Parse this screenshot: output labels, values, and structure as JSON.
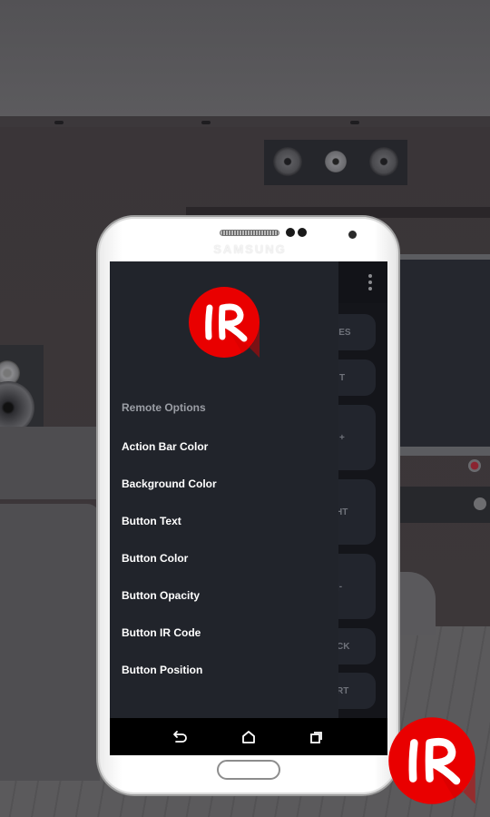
{
  "device": {
    "brand": "SAMSUNG"
  },
  "app": {
    "logo_text": "IR",
    "brand_color": "#e90000",
    "overflow_menu_icon": "more-vert-icon",
    "remote_buttons_partial": [
      "HES",
      "T",
      "+",
      "HT",
      "|-",
      "CK",
      "RT"
    ]
  },
  "drawer": {
    "section_header": "Remote Options",
    "items": [
      {
        "label": "Action Bar Color"
      },
      {
        "label": "Background Color"
      },
      {
        "label": "Button Text"
      },
      {
        "label": "Button Color"
      },
      {
        "label": "Button Opacity"
      },
      {
        "label": "Button IR Code"
      },
      {
        "label": "Button Position"
      }
    ]
  },
  "nav_bar": {
    "back_icon": "back-icon",
    "home_icon": "home-icon",
    "recents_icon": "recents-icon"
  },
  "colors": {
    "drawer_bg": "#21242b",
    "screen_bg": "#14151a",
    "remote_button_bg": "#22252d",
    "header_text": "#9b9ea5",
    "item_text": "#ffffff"
  }
}
